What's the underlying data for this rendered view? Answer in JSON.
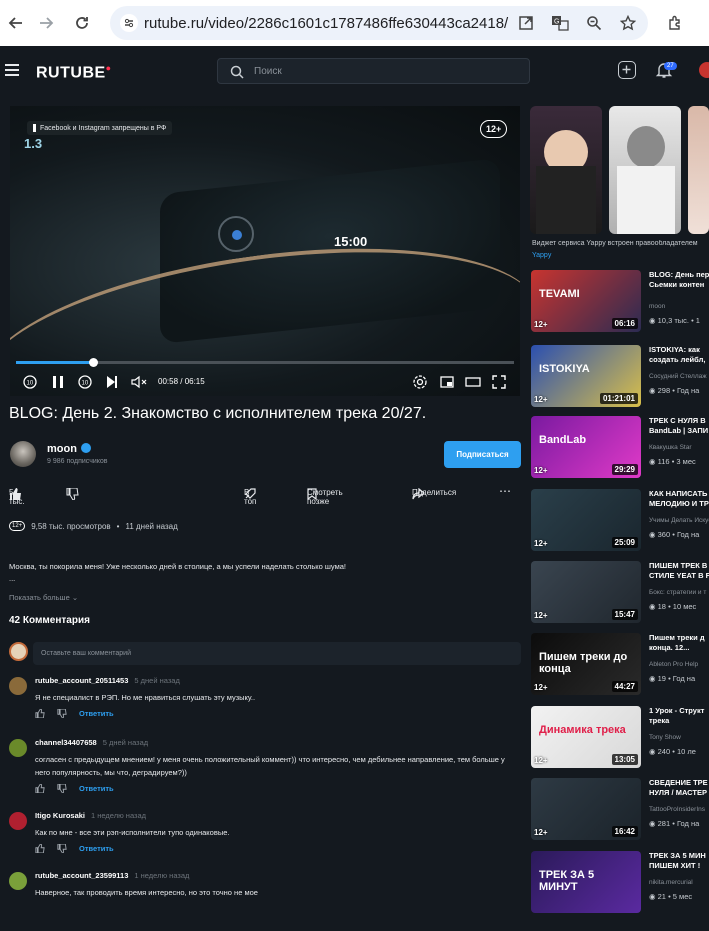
{
  "browser": {
    "url": "rutube.ru/video/2286c1601c1787486ffe630443ca2418/"
  },
  "header": {
    "logo": "RUTUBE",
    "search_placeholder": "Поиск",
    "notifications_count": "27"
  },
  "player": {
    "notice": "Facebook и Instagram запрещены в РФ",
    "age_badge": "12+",
    "frame_speed": "1.3",
    "frame_clock": "15:00",
    "time": "00:58 / 06:15",
    "progress": 0.155
  },
  "video": {
    "title": "BLOG: День 2. Знакомство с исполнителем трека 20/27.",
    "channel": "moon",
    "subscribers": "9 986 подписчиков",
    "subscribe_label": "Подписаться",
    "likes": "5 тыс.",
    "to_top": "В топ",
    "watch_later": "Смотреть позже",
    "share": "Поделиться",
    "age": "12+",
    "views": "9,58 тыс. просмотров",
    "date": "11 дней назад",
    "description": [
      "Москва, ты покорила меня! Уже несколько дней в столице, а мы успели наделать столько шума!",
      "..."
    ],
    "show_more": "Показать больше"
  },
  "comments": {
    "count_label": "42 Комментария",
    "input_placeholder": "Оставьте ваш комментарий",
    "reply_label": "Ответить",
    "items": [
      {
        "user": "rutube_account_20511453",
        "date": "5 дней назад",
        "text": "Я не специалист в РЭП. Но ме нравиться слушать эту музыку..",
        "avatar_color": "#8a6a3a"
      },
      {
        "user": "channel34407658",
        "date": "5 дней назад",
        "text": "согласен с предыдущем мнением! у меня очень положительный коммент)) что интересно, чем дебильнее направление, тем больше у него популярность, мы что, деградируем?))",
        "avatar_color": "#6a8a2a"
      },
      {
        "user": "Itigo Kurosaki",
        "date": "1 неделю назад",
        "text": "Как по мне - все эти рэп-исполнители тупо одинаковые.",
        "avatar_color": "#b02030"
      },
      {
        "user": "rutube_account_23599113",
        "date": "1 неделю назад",
        "text": "Наверное, так проводить время интересно, но это точно не мое",
        "avatar_color": "#7aa03a"
      }
    ]
  },
  "sidebar": {
    "shorts_caption": "Виджет сервиса Yappy встроен правообладателем",
    "shorts_source": "Yappy",
    "cards": [
      {
        "title": "BLOG: День пер",
        "title2": "Сьемки контен",
        "channel": "moon",
        "views": "10,3 тыс.",
        "ago": "1",
        "duration": "06:16",
        "age": "12+",
        "thumb_text": "TEVAMI",
        "color1": "#c8342f",
        "color2": "#2b2b52"
      },
      {
        "title": "ISTOKIYA: как",
        "title2": "создать лейбл,",
        "channel": "Сосудний Стеллаж",
        "views": "298",
        "ago": "Год на",
        "duration": "01:21:01",
        "age": "12+",
        "thumb_text": "ISTOKIYA",
        "color1": "#2b4fb0",
        "color2": "#d9c04a"
      },
      {
        "title": "ТРЕК С НУЛЯ В",
        "title2": "BandLab | ЗАПИ",
        "channel": "Квакушка Star",
        "views": "116",
        "ago": "3 мес",
        "duration": "29:29",
        "age": "12+",
        "thumb_text": "BandLab",
        "color1": "#7a1aa0",
        "color2": "#e03ac8"
      },
      {
        "title": "КАК НАПИСАТЬ",
        "title2": "МЕЛОДИЮ И ТР",
        "channel": "Учимы Делать Искус",
        "views": "360",
        "ago": "Год на",
        "duration": "25:09",
        "age": "12+",
        "thumb_text": "",
        "color1": "#2a3f4a",
        "color2": "#1a262e"
      },
      {
        "title": "ПИШЕМ ТРЕК В",
        "title2": "СТИЛЕ YEAT В F",
        "channel": "Бокс: стратегии и т",
        "views": "18",
        "ago": "10 мес",
        "duration": "15:47",
        "age": "12+",
        "thumb_text": "",
        "color1": "#3a4550",
        "color2": "#20272e"
      },
      {
        "title": "Пишем треки д",
        "title2": "конца. 12...",
        "channel": "Ableton Pro Help",
        "views": "19",
        "ago": "Год на",
        "duration": "44:27",
        "age": "12+",
        "thumb_text": "Пишем треки до конца",
        "color1": "#0c0c0c",
        "color2": "#2a2a2a"
      },
      {
        "title": "1 Урок - Структ",
        "title2": "трека",
        "channel": "Tony Show",
        "views": "240",
        "ago": "10 ле",
        "duration": "13:05",
        "age": "12+",
        "thumb_text": "Динамика трека",
        "color1": "#f2f2f2",
        "color2": "#d8d8d8"
      },
      {
        "title": "СВЕДЕНИЕ ТРЕ",
        "title2": "НУЛЯ / МАСТЕР",
        "channel": "TattooProInsiderIns",
        "views": "281",
        "ago": "Год на",
        "duration": "16:42",
        "age": "12+",
        "thumb_text": "",
        "color1": "#2e3a44",
        "color2": "#1b232a"
      },
      {
        "title": "ТРЕК ЗА 5 МИН",
        "title2": "ПИШЕМ ХИТ !",
        "channel": "nikita.mercurial",
        "views": "21",
        "ago": "5 мес",
        "duration": "",
        "age": "",
        "thumb_text": "ТРЕК ЗА 5 МИНУТ",
        "color1": "#2b1a5a",
        "color2": "#5a2aa0"
      }
    ]
  }
}
